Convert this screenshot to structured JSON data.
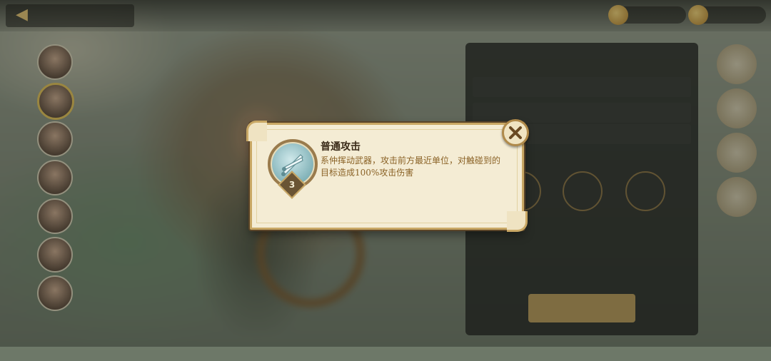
{
  "tooltip": {
    "skill_name": "普通攻击",
    "skill_desc": "系仲挥动武器，攻击前方最近单位，对触碰到的目标造成100%攻击伤害",
    "level": "3",
    "icon": "twin-blades-icon",
    "close_icon": "close-x-icon"
  },
  "colors": {
    "parchment": "#f4ecd4",
    "gold_border": "#c9a865",
    "title_text": "#3a2a18",
    "desc_text": "#8a6226"
  }
}
